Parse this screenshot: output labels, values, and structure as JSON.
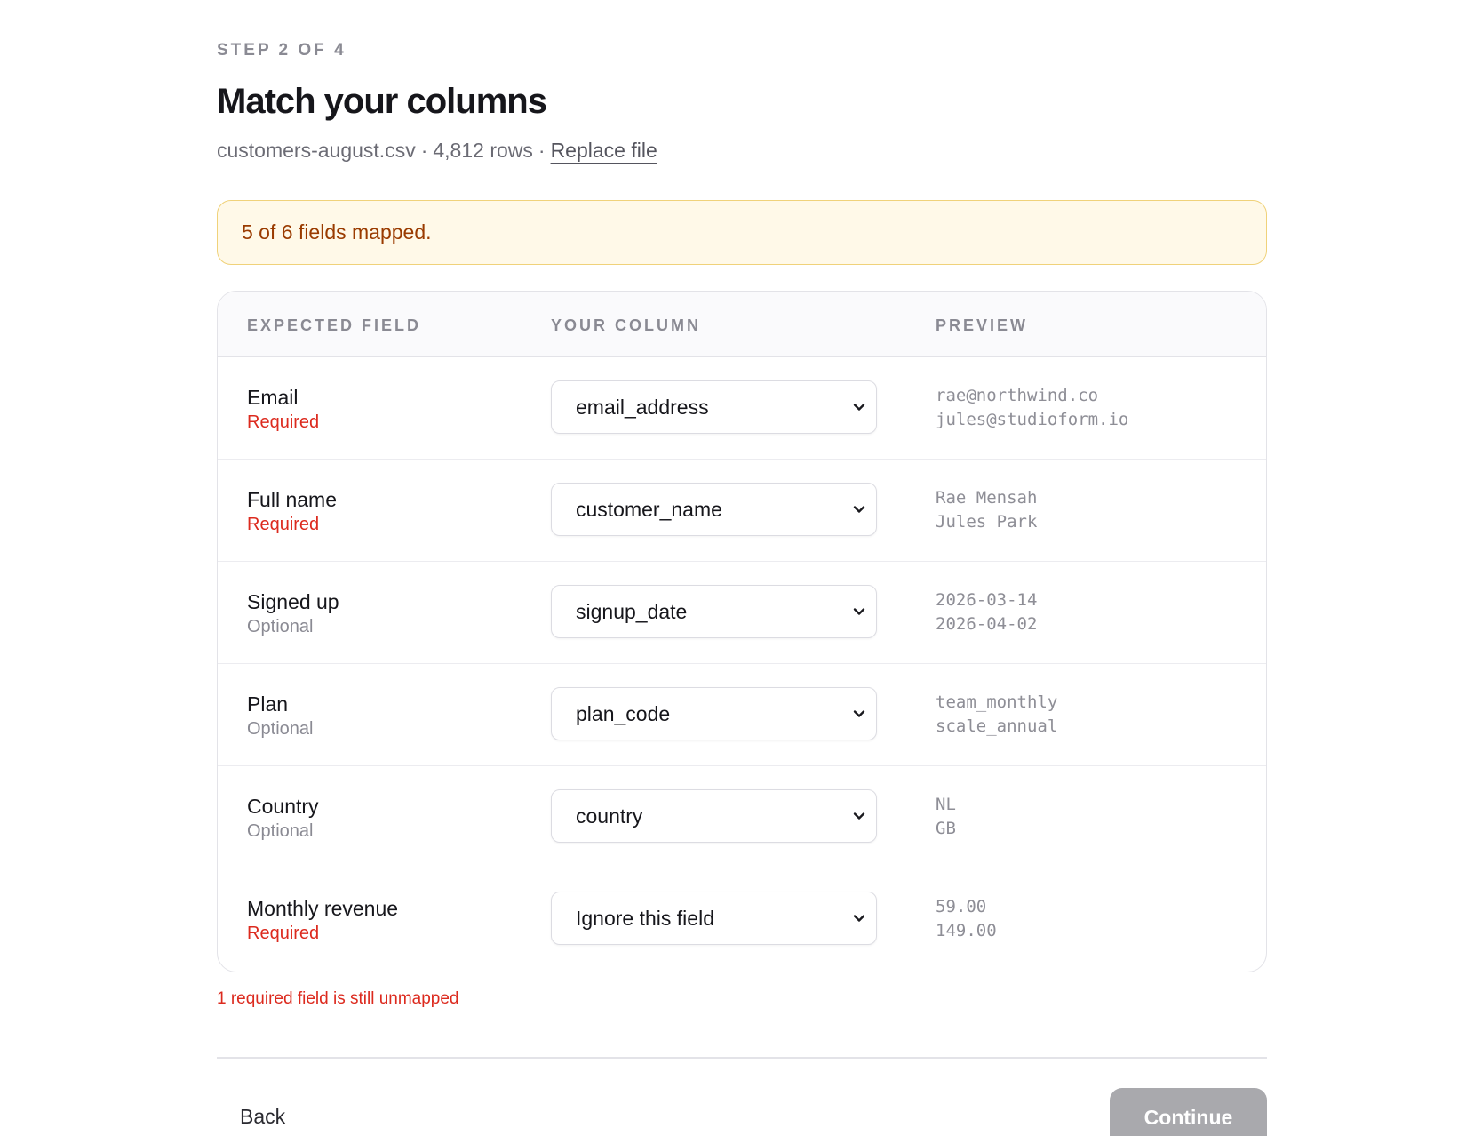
{
  "header": {
    "step": "STEP 2 OF 4",
    "title": "Match your columns",
    "file_name": "customers-august.csv",
    "separator": "·",
    "row_count": "4,812 rows",
    "replace_link": "Replace file"
  },
  "banner": {
    "message": "5 of 6 fields mapped."
  },
  "table": {
    "columns": [
      "EXPECTED FIELD",
      "YOUR COLUMN",
      "PREVIEW"
    ],
    "rows": [
      {
        "field": "Email",
        "requirement": "Required",
        "column": "email_address",
        "preview": [
          "rae@northwind.co",
          "jules@studioform.io"
        ]
      },
      {
        "field": "Full name",
        "requirement": "Required",
        "column": "customer_name",
        "preview": [
          "Rae Mensah",
          "Jules Park"
        ]
      },
      {
        "field": "Signed up",
        "requirement": "Optional",
        "column": "signup_date",
        "preview": [
          "2026-03-14",
          "2026-04-02"
        ]
      },
      {
        "field": "Plan",
        "requirement": "Optional",
        "column": "plan_code",
        "preview": [
          "team_monthly",
          "scale_annual"
        ]
      },
      {
        "field": "Country",
        "requirement": "Optional",
        "column": "country",
        "preview": [
          "NL",
          "GB"
        ]
      },
      {
        "field": "Monthly revenue",
        "requirement": "Required",
        "column": "Ignore this field",
        "preview": [
          "59.00",
          "149.00"
        ]
      }
    ]
  },
  "validation": {
    "error": "1 required field is still unmapped"
  },
  "footer": {
    "back_label": "Back",
    "continue_label": "Continue"
  },
  "colors": {
    "required": "#dc2a1e",
    "optional": "#8a8a93",
    "banner_bg": "#fff9e8",
    "banner_border": "#f0d27a",
    "banner_text": "#9a3b00",
    "continue_disabled": "#a9a9ad"
  },
  "icons": {
    "select_chevron": "chevron-down-icon"
  }
}
